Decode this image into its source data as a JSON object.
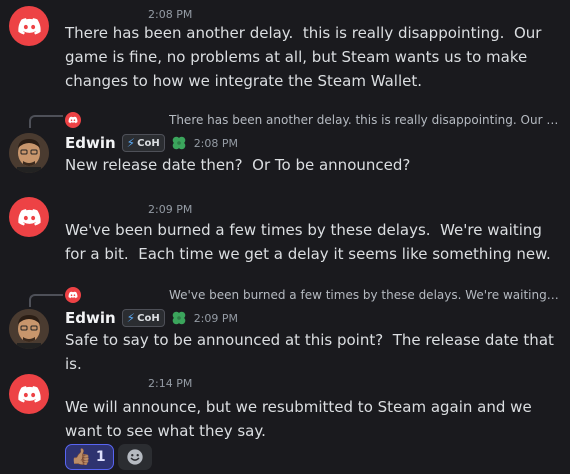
{
  "messages": [
    {
      "time": "2:08 PM",
      "text": "There has been another delay.  this is really disappointing.  Our game is fine, no problems at all, but Steam wants us to make changes to how we integrate the Steam Wallet.",
      "avatar_icon": "discord-logo-icon"
    },
    {
      "reply_text": "There has been another delay.  this is really disappointing.  Our game is fine, no problems at all, but Steam wants us to make changes to how we integrate the Steam Wallet.",
      "username": "Edwin",
      "tag": "CoH",
      "badge_icon": "clover-icon",
      "time": "2:08 PM",
      "text": "New release date then?  Or To be announced?"
    },
    {
      "time": "2:09 PM",
      "text": "We've been burned a few times by these delays.  We're waiting for a bit.  Each time we get a delay it seems like something new."
    },
    {
      "reply_text": "We've been burned a few times by these delays.  We're waiting for a bit.  Each time we get a delay it seems like something new.",
      "username": "Edwin",
      "tag": "CoH",
      "badge_icon": "clover-icon",
      "time": "2:09 PM",
      "text": "Safe to say to be announced at this point?  The release date that is."
    },
    {
      "time": "2:14 PM",
      "text": "We will announce, but we resubmitted to Steam again and we want to see what they say."
    }
  ],
  "reactions": [
    {
      "emoji": "👍🏽",
      "count": "1"
    }
  ],
  "colors": {
    "discord_red": "#ed4245",
    "background": "#1a1a1e",
    "reaction_blurple": "#5865f2"
  }
}
